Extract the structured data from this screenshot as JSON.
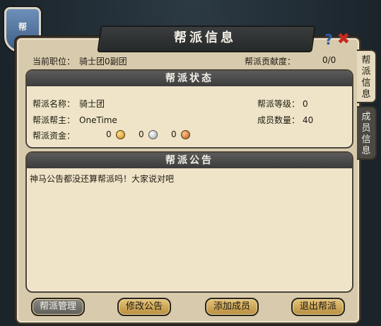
{
  "window": {
    "title": "帮派信息",
    "emblem_char": "帮"
  },
  "header_controls": {
    "help_icon": "question-mark-icon",
    "close_icon": "close-x-icon",
    "help_glyph": "?",
    "close_glyph": "✖"
  },
  "top_info": {
    "position_label": "当前职位：",
    "position_value": "骑士团0副团",
    "contribution_label": "帮派贡献度：",
    "contribution_value": "0/0"
  },
  "status": {
    "heading": "帮派状态",
    "name_label": "帮派名称：",
    "name_value": "骑士团",
    "leader_label": "帮派帮主：",
    "leader_value": "OneTime",
    "funds_label": "帮派资金：",
    "funds_gold": "0",
    "funds_silver": "0",
    "funds_copper": "0",
    "level_label": "帮派等级：",
    "level_value": "0",
    "members_label": "成员数量：",
    "members_value": "40"
  },
  "announcement": {
    "heading": "帮派公告",
    "text": "神马公告都没还算帮派吗！大家说对吧"
  },
  "side_tabs": [
    {
      "label": "帮派信息",
      "active": true
    },
    {
      "label": "成员信息",
      "active": false
    }
  ],
  "buttons": {
    "manage": "帮派管理",
    "edit_notice": "修改公告",
    "add_member": "添加成员",
    "leave": "退出帮派"
  },
  "colors": {
    "panel": "#d8cbad",
    "section_head": "#4a4a4a",
    "gold_button": "#d4ae5e",
    "close": "#c8281e",
    "help": "#2c5fa8"
  }
}
